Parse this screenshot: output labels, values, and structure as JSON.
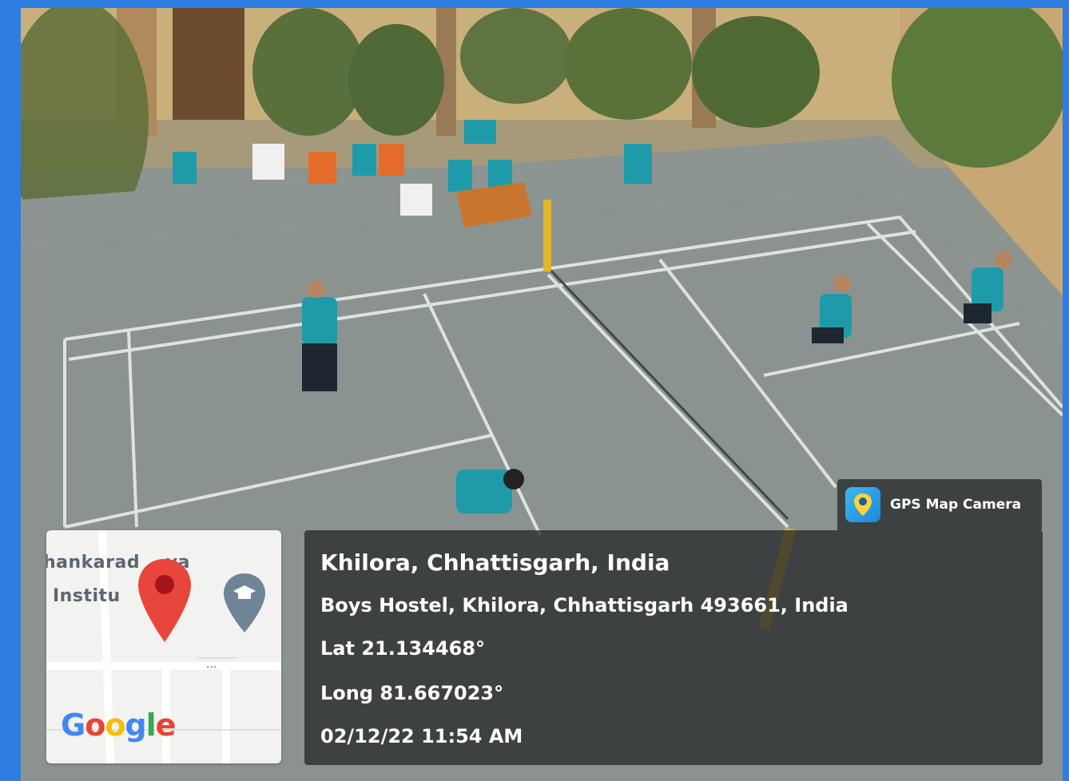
{
  "overlay": {
    "badge": {
      "app_name": "GPS Map Camera",
      "icon": "gps-map-camera-icon"
    },
    "location_title": "Khilora, Chhattisgarh, India",
    "address": "Boys Hostel, Khilora, Chhattisgarh 493661, India",
    "latitude": "Lat 21.134468°",
    "longitude": "Long 81.667023°",
    "datetime": "02/12/22 11:54 AM"
  },
  "map": {
    "place_line1": "hankarad    ya",
    "place_line2": "Institu    f...",
    "pin_icon": "location-pin-icon",
    "place_icon": "education-place-icon",
    "brand": "Google"
  },
  "colors": {
    "frame": "#2e7de0",
    "pin": "#e8453c",
    "panel": "#282a2c"
  }
}
